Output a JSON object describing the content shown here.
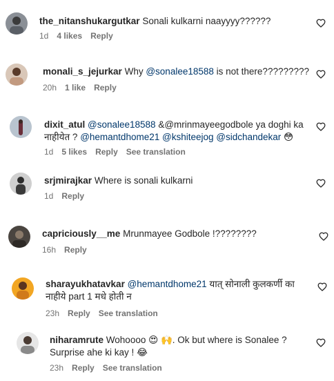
{
  "comments": [
    {
      "username": "the_nitanshukargutkar",
      "text": "Sonali kulkarni naayyyy??????",
      "time": "1d",
      "likes": "4 likes",
      "reply": "Reply"
    },
    {
      "username": "monali_s_jejurkar",
      "pre": "Why ",
      "mention": "@sonalee18588",
      "post": " is not there?????????",
      "time": "20h",
      "likes": "1 like",
      "reply": "Reply"
    },
    {
      "username": "dixit_atul",
      "m1": "@sonalee18588",
      "t1": " &@mrinmayeegodbole ya doghi ka",
      "t2": "नाहीयेत ? ",
      "m2": "@hemantdhome21",
      "m3": "@kshiteejog",
      "m4": "@sidchandekar",
      "emoji": "😳",
      "time": "1d",
      "likes": "5 likes",
      "reply": "Reply",
      "translation": "See translation"
    },
    {
      "username": "srjmirajkar",
      "text": "Where is sonali kulkarni",
      "time": "1d",
      "reply": "Reply"
    },
    {
      "username": "capriciously__me",
      "text": "Mrunmayee Godbole !????????",
      "time": "16h",
      "reply": "Reply"
    },
    {
      "username": "sharayukhatavkar",
      "mention": "@hemantdhome21",
      "t1": " यात् सोनाली कुलकर्णी का",
      "t2": "नाहीये part 1 मधे होती न",
      "time": "23h",
      "reply": "Reply",
      "translation": "See translation"
    },
    {
      "username": "niharamrute",
      "t1": "Wohoooo ",
      "e1": "😍",
      "e2": "🙌",
      "t1b": ". Ok but where is Sonalee ?",
      "t2": "Surprise ahe ki kay ! ",
      "e3": "😂",
      "time": "23h",
      "reply": "Reply",
      "translation": "See translation"
    }
  ],
  "icons": {
    "like": "heart-outline-icon"
  }
}
